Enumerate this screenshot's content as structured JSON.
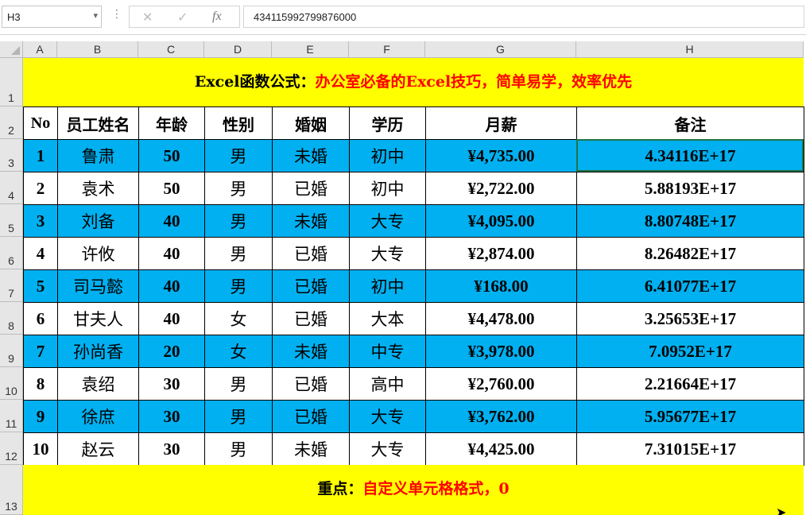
{
  "formula_bar": {
    "name_box": "H3",
    "dropdown_icon": "▾",
    "cancel_icon": "✕",
    "enter_icon": "✓",
    "fx_label": "fx",
    "value": "434115992799876000"
  },
  "columns": [
    "A",
    "B",
    "C",
    "D",
    "E",
    "F",
    "G",
    "H"
  ],
  "row_numbers": [
    "1",
    "2",
    "3",
    "4",
    "5",
    "6",
    "7",
    "8",
    "9",
    "10",
    "11",
    "12",
    "13"
  ],
  "title_band": {
    "black": "Excel函数公式：",
    "red": "办公室必备的Excel技巧，简单易学，效率优先"
  },
  "footer_band": {
    "black": "重点：",
    "red": "自定义单元格格式，0"
  },
  "table": {
    "headers": [
      "No",
      "员工姓名",
      "年龄",
      "性别",
      "婚姻",
      "学历",
      "月薪",
      "备注"
    ],
    "rows": [
      [
        "1",
        "鲁肃",
        "50",
        "男",
        "未婚",
        "初中",
        "¥4,735.00",
        "4.34116E+17"
      ],
      [
        "2",
        "袁术",
        "50",
        "男",
        "已婚",
        "初中",
        "¥2,722.00",
        "5.88193E+17"
      ],
      [
        "3",
        "刘备",
        "40",
        "男",
        "未婚",
        "大专",
        "¥4,095.00",
        "8.80748E+17"
      ],
      [
        "4",
        "许攸",
        "40",
        "男",
        "已婚",
        "大专",
        "¥2,874.00",
        "8.26482E+17"
      ],
      [
        "5",
        "司马懿",
        "40",
        "男",
        "已婚",
        "初中",
        "¥168.00",
        "6.41077E+17"
      ],
      [
        "6",
        "甘夫人",
        "40",
        "女",
        "已婚",
        "大本",
        "¥4,478.00",
        "3.25653E+17"
      ],
      [
        "7",
        "孙尚香",
        "20",
        "女",
        "未婚",
        "中专",
        "¥3,978.00",
        "7.0952E+17"
      ],
      [
        "8",
        "袁绍",
        "30",
        "男",
        "已婚",
        "高中",
        "¥2,760.00",
        "2.21664E+17"
      ],
      [
        "9",
        "徐庶",
        "30",
        "男",
        "已婚",
        "大专",
        "¥3,762.00",
        "5.95677E+17"
      ],
      [
        "10",
        "赵云",
        "30",
        "男",
        "未婚",
        "大专",
        "¥4,425.00",
        "7.31015E+17"
      ]
    ]
  },
  "colors": {
    "band": "#ffff00",
    "stripe": "#00b0f0",
    "red_text": "#ff0000",
    "selection": "#217346"
  }
}
